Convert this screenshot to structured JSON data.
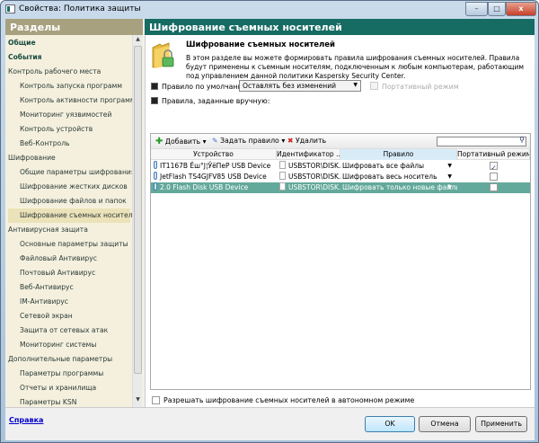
{
  "window": {
    "title": "Свойства: Политика защиты",
    "controls": {
      "minimize": "–",
      "maximize": "□",
      "close": "x"
    }
  },
  "sidebar": {
    "header": "Разделы",
    "items": [
      {
        "label": "Общие",
        "level": 0,
        "bold": true
      },
      {
        "label": "События",
        "level": 0,
        "bold": true
      },
      {
        "label": "Контроль рабочего места",
        "level": 0
      },
      {
        "label": "Контроль запуска программ",
        "level": 1
      },
      {
        "label": "Контроль активности программ",
        "level": 1
      },
      {
        "label": "Мониторинг уязвимостей",
        "level": 1
      },
      {
        "label": "Контроль устройств",
        "level": 1
      },
      {
        "label": "Веб-Контроль",
        "level": 1
      },
      {
        "label": "Шифрование",
        "level": 0
      },
      {
        "label": "Общие параметры шифрования",
        "level": 1
      },
      {
        "label": "Шифрование жестких дисков",
        "level": 1
      },
      {
        "label": "Шифрование файлов и папок",
        "level": 1
      },
      {
        "label": "Шифрование съемных носителей",
        "level": 1,
        "selected": true
      },
      {
        "label": "Антивирусная защита",
        "level": 0
      },
      {
        "label": "Основные параметры защиты",
        "level": 1
      },
      {
        "label": "Файловый Антивирус",
        "level": 1
      },
      {
        "label": "Почтовый Антивирус",
        "level": 1
      },
      {
        "label": "Веб-Антивирус",
        "level": 1
      },
      {
        "label": "IM-Антивирус",
        "level": 1
      },
      {
        "label": "Сетевой экран",
        "level": 1
      },
      {
        "label": "Защита от сетевых атак",
        "level": 1
      },
      {
        "label": "Мониторинг системы",
        "level": 1
      },
      {
        "label": "Дополнительные параметры",
        "level": 0
      },
      {
        "label": "Параметры программы",
        "level": 1
      },
      {
        "label": "Отчеты и хранилища",
        "level": 1
      },
      {
        "label": "Параметры KSN",
        "level": 1
      }
    ]
  },
  "main": {
    "header": "Шифрование съемных носителей",
    "section_title": "Шифрование съемных носителей",
    "description": "В этом разделе вы можете формировать правила шифрования съемных носителей. Правила будут применены к съемным носителям, подключенным к любым компьютерам, работающим под управлением данной политики Kaspersky Security Center.",
    "default_rule_label": "Правило по умолчанию:",
    "default_rule_value": "Оставлять без изменений",
    "portable_mode_label": "Портативный режим",
    "portable_mode_checked": false,
    "manual_rules_label": "Правила, заданные вручную:",
    "toolbar": {
      "add": "Добавить",
      "set_rule": "Задать правило",
      "delete": "Удалить",
      "search_placeholder": ""
    },
    "columns": [
      "Устройство",
      "Идентификатор ...",
      "Правило",
      "Портативный режим"
    ],
    "rows": [
      {
        "device": "IT1167B Ёш°Ј¦ЎёПеР USB Device",
        "id": "USBSTOR\\DISK...",
        "rule": "Шифровать все файлы",
        "portable": true,
        "selected": false
      },
      {
        "device": "JetFlash TS4GJFV85 USB Device",
        "id": "USBSTOR\\DISK...",
        "rule": "Шифровать весь носитель",
        "portable": false,
        "selected": false
      },
      {
        "device": "2.0 Flash Disk USB Device",
        "id": "USBSTOR\\DISK...",
        "rule": "Шифровать только новые файлы",
        "portable": false,
        "selected": true
      }
    ],
    "offline_label": "Разрешать шифрование съемных носителей в автономном режиме",
    "offline_checked": false
  },
  "footer": {
    "help": "Справка",
    "ok": "OK",
    "cancel": "Отмена",
    "apply": "Применить"
  },
  "colors": {
    "teal": "#166b63",
    "sidebar_bg": "#f5f0de",
    "selected_row": "#63a99b"
  }
}
